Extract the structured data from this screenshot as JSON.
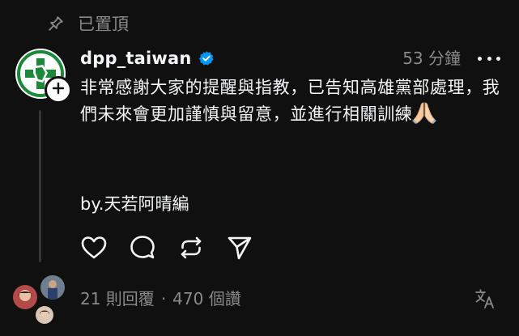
{
  "pinned": {
    "label": "已置頂"
  },
  "post": {
    "username": "dpp_taiwan",
    "verified": true,
    "timestamp": "53 分鐘",
    "body": "非常感謝大家的提醒與指教，已告知高雄黨部處理，我們未來會更加謹慎與留意，並進行相關訓練",
    "emoji": "folded-hands",
    "byline": "by.天若阿晴編"
  },
  "actions": [
    "like",
    "reply",
    "repost",
    "share"
  ],
  "footer": {
    "replies": "21 則回覆",
    "separator": "·",
    "likes": "470 個讚"
  },
  "colors": {
    "background": "#101010",
    "text": "#f3f5f7",
    "muted": "#8a8a8a",
    "verified": "#0095f6",
    "brand_green": "#1a8a3a"
  },
  "icons": {
    "pin": "pin-icon",
    "verified": "verified-badge-icon",
    "more": "more-icon",
    "like": "heart-icon",
    "reply": "comment-icon",
    "repost": "repost-icon",
    "share": "send-icon",
    "translate": "translate-icon",
    "follow": "plus-icon"
  }
}
